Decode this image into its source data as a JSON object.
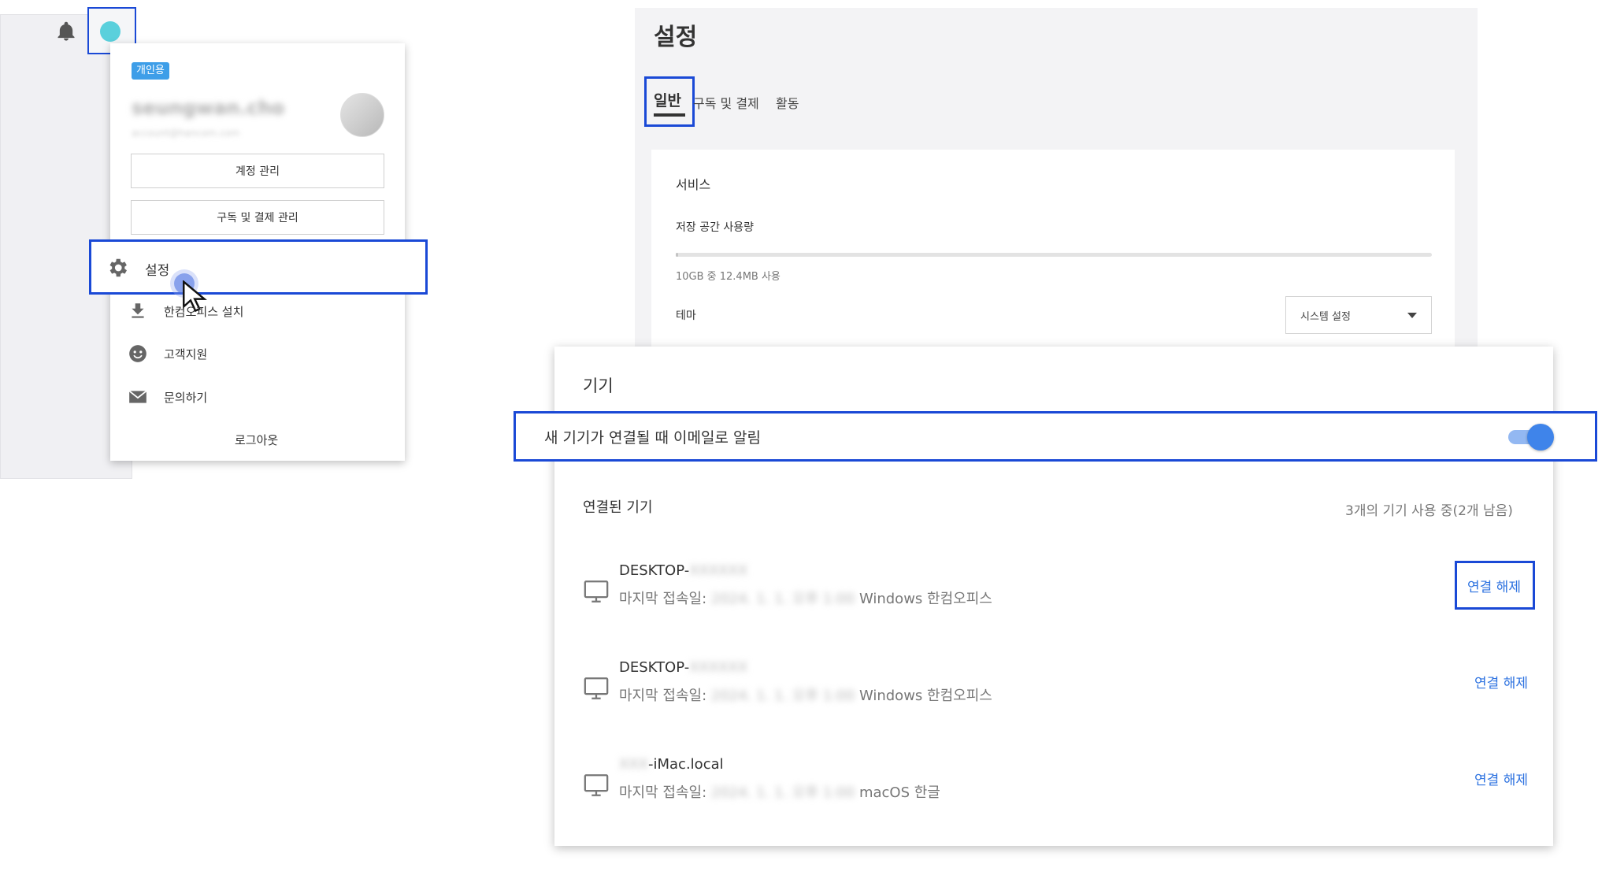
{
  "menu": {
    "badge": "개인용",
    "user_name": "seungwan.cho",
    "user_email": "account@hancom.com",
    "account_button": "계정 관리",
    "subscribe_button": "구독 및 결제 관리",
    "settings": "설정",
    "install": "한컴오피스 설치",
    "support": "고객지원",
    "contact": "문의하기",
    "logout": "로그아웃"
  },
  "settings_page": {
    "title": "설정",
    "tabs": [
      "일반",
      "구독 및 결제",
      "활동"
    ],
    "service_title": "서비스",
    "storage_label": "저장 공간 사용량",
    "storage_text": "10GB 중 12.4MB 사용",
    "storage_fraction": 0.0012,
    "theme_label": "테마",
    "theme_value": "시스템 설정"
  },
  "devices": {
    "title": "기기",
    "notify_label": "새 기기가 연결될 때 이메일로 알림",
    "notify_enabled": true,
    "connected_title": "연결된 기기",
    "count_text": "3개의 기기 사용 중(2개 남음)",
    "disconnect_label": "연결 해제",
    "list": [
      {
        "name_prefix": "DESKTOP-",
        "name_hidden": "XXXXXX",
        "last_label": "마지막 접속일:",
        "last_hidden": "2024. 1. 1. 오후 1:00",
        "platform": "Windows 한컴오피스"
      },
      {
        "name_prefix": "DESKTOP-",
        "name_hidden": "XXXXXX",
        "last_label": "마지막 접속일:",
        "last_hidden": "2024. 1. 1. 오후 1:00",
        "platform": "Windows 한컴오피스"
      },
      {
        "name_prefix": "XXX",
        "name_suffix": "-iMac.local",
        "last_label": "마지막 접속일:",
        "last_hidden": "2024. 1. 1. 오후 1:00",
        "platform": "macOS 한글"
      }
    ]
  },
  "colors": {
    "highlight": "#1a49d6",
    "link": "#2d72e0",
    "toggle": "#3f84ea",
    "badge": "#3e9ee8"
  }
}
